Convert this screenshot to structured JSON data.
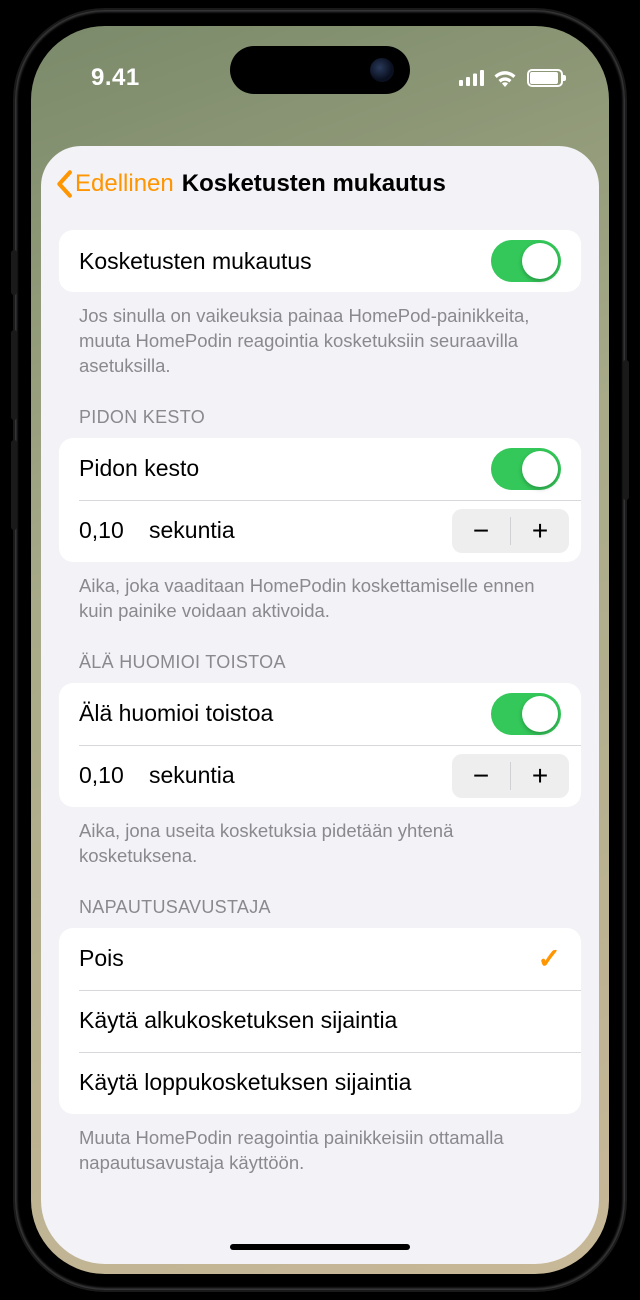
{
  "status": {
    "time": "9.41"
  },
  "nav": {
    "back": "Edellinen",
    "title": "Kosketusten mukautus"
  },
  "accom": {
    "label": "Kosketusten mukautus",
    "on": true,
    "footer": "Jos sinulla on vaikeuksia painaa HomePod-painikkeita, muuta HomePodin reagointia kosketuksiin seuraavilla asetuksilla."
  },
  "hold": {
    "header": "PIDON KESTO",
    "label": "Pidon kesto",
    "on": true,
    "value": "0,10",
    "unit": "sekuntia",
    "footer": "Aika, joka vaaditaan HomePodin koskettamiselle ennen kuin painike voidaan aktivoida."
  },
  "ignore": {
    "header": "ÄLÄ HUOMIOI TOISTOA",
    "label": "Älä huomioi toistoa",
    "on": true,
    "value": "0,10",
    "unit": "sekuntia",
    "footer": "Aika, jona useita kosketuksia pidetään yhtenä kosketuksena."
  },
  "tap": {
    "header": "NAPAUTUSAVUSTAJA",
    "options": [
      {
        "label": "Pois",
        "selected": true
      },
      {
        "label": "Käytä alkukosketuksen sijaintia",
        "selected": false
      },
      {
        "label": "Käytä loppukosketuksen sijaintia",
        "selected": false
      }
    ],
    "footer": "Muuta HomePodin reagointia painikkeisiin ottamalla napautusavustaja käyttöön."
  },
  "glyph": {
    "minus": "−",
    "plus": "+"
  }
}
